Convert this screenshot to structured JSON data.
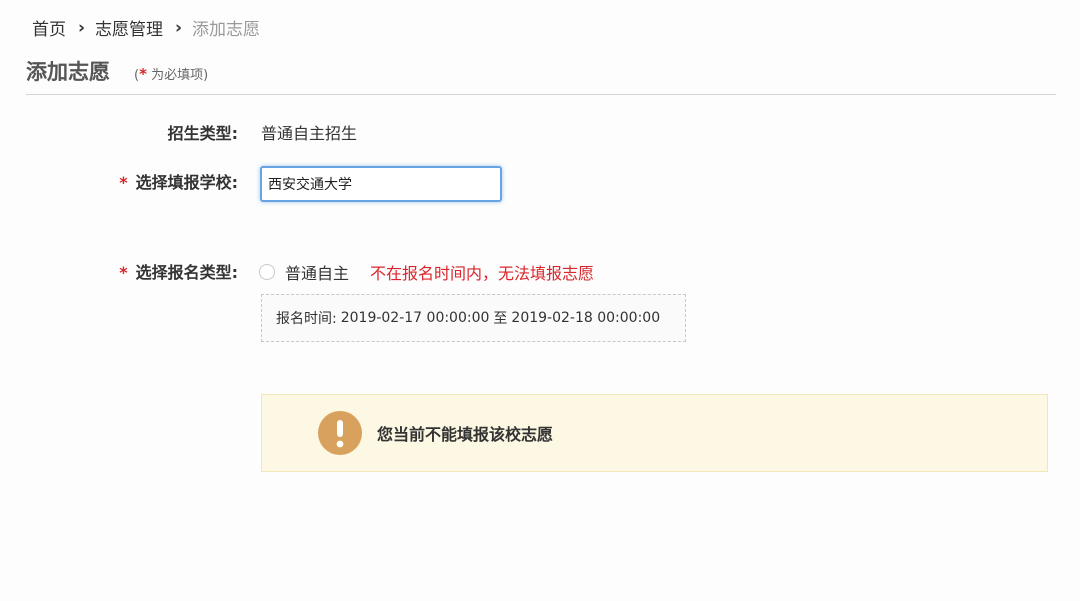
{
  "breadcrumb": {
    "home": "首页",
    "section": "志愿管理",
    "current": "添加志愿"
  },
  "header": {
    "title": "添加志愿",
    "required_note": {
      "open": "(",
      "star": "*",
      "text": " 为必填项)"
    }
  },
  "form": {
    "recruit_type": {
      "label": "招生类型:",
      "value": "普通自主招生"
    },
    "school": {
      "required_mark": "*",
      "label": "选择填报学校:",
      "value": "西安交通大学"
    },
    "apply_type": {
      "required_mark": "*",
      "label": "选择报名类型:",
      "option_label": "普通自主",
      "option_selected": false,
      "warning": "不在报名时间内，无法填报志愿",
      "time_label": "报名时间:",
      "time_start": "2019-02-17 00:00:00",
      "time_to": "至",
      "time_end": "2019-02-18 00:00:00"
    }
  },
  "alert": {
    "icon": "exclamation-icon",
    "message": "您当前不能填报该校志愿",
    "color_bg": "#fcf8e3",
    "color_icon": "#d9a15e"
  },
  "colors": {
    "required": "#d9262c",
    "input_focus_border": "#68a4e2"
  }
}
